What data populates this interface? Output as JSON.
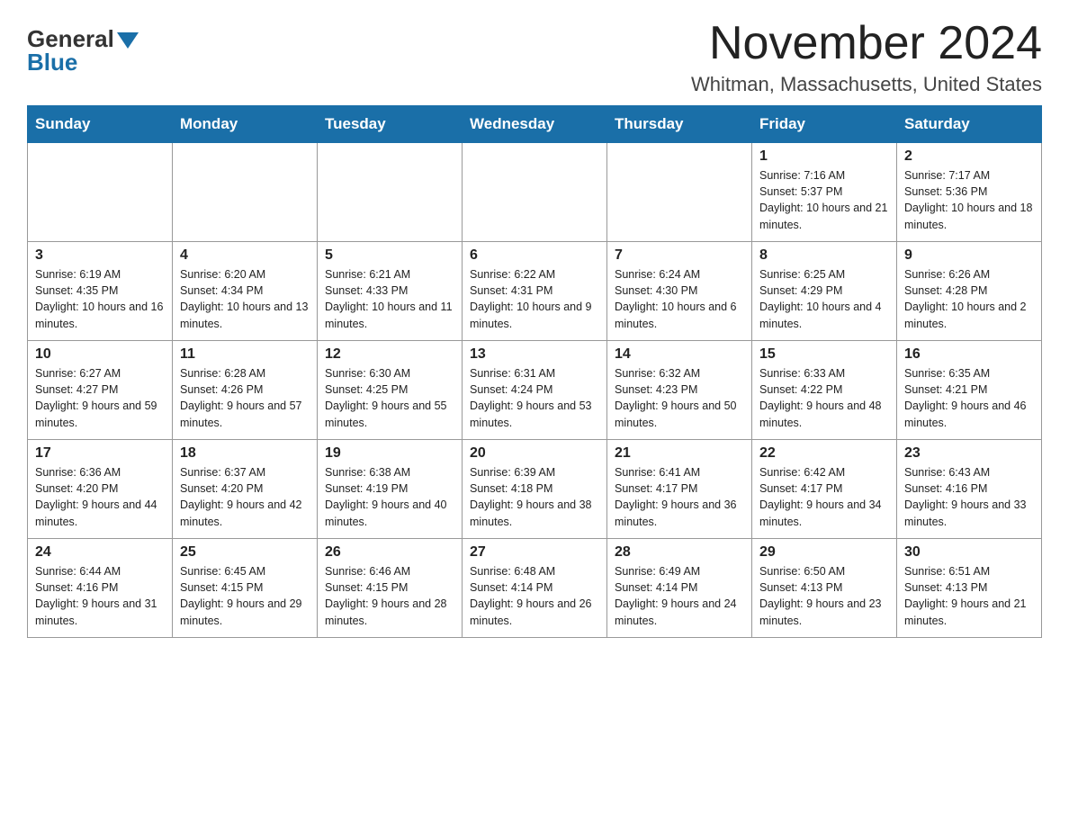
{
  "logo": {
    "general": "General",
    "blue": "Blue"
  },
  "header": {
    "month": "November 2024",
    "location": "Whitman, Massachusetts, United States"
  },
  "weekdays": [
    "Sunday",
    "Monday",
    "Tuesday",
    "Wednesday",
    "Thursday",
    "Friday",
    "Saturday"
  ],
  "weeks": [
    [
      {
        "day": "",
        "info": ""
      },
      {
        "day": "",
        "info": ""
      },
      {
        "day": "",
        "info": ""
      },
      {
        "day": "",
        "info": ""
      },
      {
        "day": "",
        "info": ""
      },
      {
        "day": "1",
        "info": "Sunrise: 7:16 AM\nSunset: 5:37 PM\nDaylight: 10 hours and 21 minutes."
      },
      {
        "day": "2",
        "info": "Sunrise: 7:17 AM\nSunset: 5:36 PM\nDaylight: 10 hours and 18 minutes."
      }
    ],
    [
      {
        "day": "3",
        "info": "Sunrise: 6:19 AM\nSunset: 4:35 PM\nDaylight: 10 hours and 16 minutes."
      },
      {
        "day": "4",
        "info": "Sunrise: 6:20 AM\nSunset: 4:34 PM\nDaylight: 10 hours and 13 minutes."
      },
      {
        "day": "5",
        "info": "Sunrise: 6:21 AM\nSunset: 4:33 PM\nDaylight: 10 hours and 11 minutes."
      },
      {
        "day": "6",
        "info": "Sunrise: 6:22 AM\nSunset: 4:31 PM\nDaylight: 10 hours and 9 minutes."
      },
      {
        "day": "7",
        "info": "Sunrise: 6:24 AM\nSunset: 4:30 PM\nDaylight: 10 hours and 6 minutes."
      },
      {
        "day": "8",
        "info": "Sunrise: 6:25 AM\nSunset: 4:29 PM\nDaylight: 10 hours and 4 minutes."
      },
      {
        "day": "9",
        "info": "Sunrise: 6:26 AM\nSunset: 4:28 PM\nDaylight: 10 hours and 2 minutes."
      }
    ],
    [
      {
        "day": "10",
        "info": "Sunrise: 6:27 AM\nSunset: 4:27 PM\nDaylight: 9 hours and 59 minutes."
      },
      {
        "day": "11",
        "info": "Sunrise: 6:28 AM\nSunset: 4:26 PM\nDaylight: 9 hours and 57 minutes."
      },
      {
        "day": "12",
        "info": "Sunrise: 6:30 AM\nSunset: 4:25 PM\nDaylight: 9 hours and 55 minutes."
      },
      {
        "day": "13",
        "info": "Sunrise: 6:31 AM\nSunset: 4:24 PM\nDaylight: 9 hours and 53 minutes."
      },
      {
        "day": "14",
        "info": "Sunrise: 6:32 AM\nSunset: 4:23 PM\nDaylight: 9 hours and 50 minutes."
      },
      {
        "day": "15",
        "info": "Sunrise: 6:33 AM\nSunset: 4:22 PM\nDaylight: 9 hours and 48 minutes."
      },
      {
        "day": "16",
        "info": "Sunrise: 6:35 AM\nSunset: 4:21 PM\nDaylight: 9 hours and 46 minutes."
      }
    ],
    [
      {
        "day": "17",
        "info": "Sunrise: 6:36 AM\nSunset: 4:20 PM\nDaylight: 9 hours and 44 minutes."
      },
      {
        "day": "18",
        "info": "Sunrise: 6:37 AM\nSunset: 4:20 PM\nDaylight: 9 hours and 42 minutes."
      },
      {
        "day": "19",
        "info": "Sunrise: 6:38 AM\nSunset: 4:19 PM\nDaylight: 9 hours and 40 minutes."
      },
      {
        "day": "20",
        "info": "Sunrise: 6:39 AM\nSunset: 4:18 PM\nDaylight: 9 hours and 38 minutes."
      },
      {
        "day": "21",
        "info": "Sunrise: 6:41 AM\nSunset: 4:17 PM\nDaylight: 9 hours and 36 minutes."
      },
      {
        "day": "22",
        "info": "Sunrise: 6:42 AM\nSunset: 4:17 PM\nDaylight: 9 hours and 34 minutes."
      },
      {
        "day": "23",
        "info": "Sunrise: 6:43 AM\nSunset: 4:16 PM\nDaylight: 9 hours and 33 minutes."
      }
    ],
    [
      {
        "day": "24",
        "info": "Sunrise: 6:44 AM\nSunset: 4:16 PM\nDaylight: 9 hours and 31 minutes."
      },
      {
        "day": "25",
        "info": "Sunrise: 6:45 AM\nSunset: 4:15 PM\nDaylight: 9 hours and 29 minutes."
      },
      {
        "day": "26",
        "info": "Sunrise: 6:46 AM\nSunset: 4:15 PM\nDaylight: 9 hours and 28 minutes."
      },
      {
        "day": "27",
        "info": "Sunrise: 6:48 AM\nSunset: 4:14 PM\nDaylight: 9 hours and 26 minutes."
      },
      {
        "day": "28",
        "info": "Sunrise: 6:49 AM\nSunset: 4:14 PM\nDaylight: 9 hours and 24 minutes."
      },
      {
        "day": "29",
        "info": "Sunrise: 6:50 AM\nSunset: 4:13 PM\nDaylight: 9 hours and 23 minutes."
      },
      {
        "day": "30",
        "info": "Sunrise: 6:51 AM\nSunset: 4:13 PM\nDaylight: 9 hours and 21 minutes."
      }
    ]
  ]
}
